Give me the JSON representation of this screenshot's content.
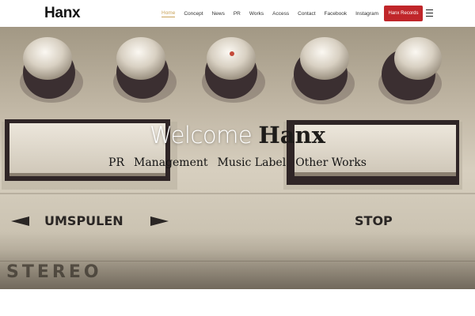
{
  "header": {
    "logo": "Hanx",
    "nav": [
      "Home",
      "Concept",
      "News",
      "PR",
      "Works",
      "Access",
      "Contact",
      "Facebook",
      "Instagram"
    ],
    "active": "Home",
    "cta": "Hanx Records",
    "accent_color": "#c9a35a",
    "cta_color": "#c0262a"
  },
  "hero": {
    "title_light": "Welcome",
    "title_bold": "Hanx",
    "tags": [
      "PR",
      "Management",
      "Music Label",
      "Other Works"
    ],
    "labels": {
      "rewind": "UMSPULEN",
      "stop": "STOP",
      "stereo": "STEREO"
    }
  }
}
